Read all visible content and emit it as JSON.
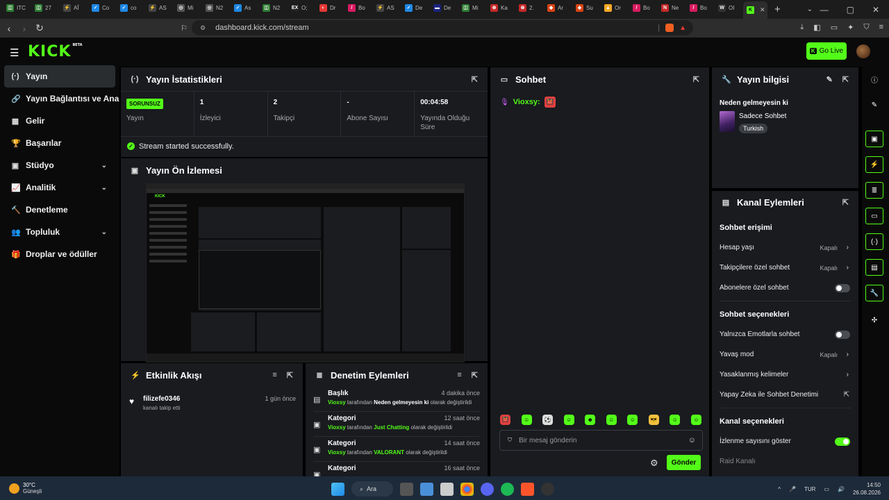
{
  "browser": {
    "tabs": [
      {
        "label": "ITC",
        "color": "#2e7d32",
        "glyph": "◫"
      },
      {
        "label": "27",
        "color": "#2e7d32",
        "glyph": "◫"
      },
      {
        "label": "AÎ",
        "color": "#444",
        "glyph": "⚡"
      },
      {
        "label": "Co",
        "color": "#1e88e5",
        "glyph": "✓"
      },
      {
        "label": "co",
        "color": "#1e88e5",
        "glyph": "✓"
      },
      {
        "label": "AS",
        "color": "#444",
        "glyph": "⚡"
      },
      {
        "label": "Mi",
        "color": "#555",
        "glyph": "◎"
      },
      {
        "label": "N2",
        "color": "#555",
        "glyph": "◎"
      },
      {
        "label": "As",
        "color": "#1e88e5",
        "glyph": "✓"
      },
      {
        "label": "N2",
        "color": "#2e7d32",
        "glyph": "◫"
      },
      {
        "label": "O;",
        "color": "#222",
        "glyph": "EX"
      },
      {
        "label": "Dr",
        "color": "#e53935",
        "glyph": "◐"
      },
      {
        "label": "Bo",
        "color": "#d81b60",
        "glyph": "/"
      },
      {
        "label": "AS",
        "color": "#444",
        "glyph": "⚡"
      },
      {
        "label": "De",
        "color": "#1e88e5",
        "glyph": "✓"
      },
      {
        "label": "De",
        "color": "#1a237e",
        "glyph": "▬"
      },
      {
        "label": "Mi",
        "color": "#2e7d32",
        "glyph": "◫"
      },
      {
        "label": "Ka",
        "color": "#c62828",
        "glyph": "⊗"
      },
      {
        "label": "2.",
        "color": "#c62828",
        "glyph": "⊗"
      },
      {
        "label": "Ar",
        "color": "#d84315",
        "glyph": "◆"
      },
      {
        "label": "Su",
        "color": "#d84315",
        "glyph": "◆"
      },
      {
        "label": "Or",
        "color": "#f9a825",
        "glyph": "▲"
      },
      {
        "label": "Bo",
        "color": "#d81b60",
        "glyph": "/"
      },
      {
        "label": "Ne",
        "color": "#c62828",
        "glyph": "N"
      },
      {
        "label": "Bo",
        "color": "#d81b60",
        "glyph": "/"
      },
      {
        "label": "OI",
        "color": "#333",
        "glyph": "W"
      },
      {
        "label": "",
        "color": "#53fc18",
        "glyph": "K",
        "active": true
      }
    ],
    "url": "dashboard.kick.com/stream"
  },
  "header": {
    "logo": "KICK",
    "logo_tag": "BETA",
    "go_live": "Go Live"
  },
  "sidebar": {
    "items": [
      {
        "label": "Yayın",
        "icon": "(·)",
        "active": true,
        "chevron": false
      },
      {
        "label": "Yayın Bağlantısı ve Anahtarı",
        "icon": "🔗",
        "chevron": false
      },
      {
        "label": "Gelir",
        "icon": "▦",
        "chevron": false
      },
      {
        "label": "Başarılar",
        "icon": "🏆",
        "chevron": false
      },
      {
        "label": "Stüdyo",
        "icon": "▣",
        "chevron": true
      },
      {
        "label": "Analitik",
        "icon": "📈",
        "chevron": true
      },
      {
        "label": "Denetleme",
        "icon": "🔨",
        "chevron": false
      },
      {
        "label": "Topluluk",
        "icon": "👥",
        "chevron": true
      },
      {
        "label": "Droplar ve ödüller",
        "icon": "🎁",
        "chevron": false
      }
    ]
  },
  "stats": {
    "title": "Yayın İstatistikleri",
    "status_badge": "SORUNSUZ",
    "status_label": "Yayın",
    "viewers_value": "1",
    "viewers_label": "İzleyici",
    "followers_value": "2",
    "followers_label": "Takipçi",
    "subs_value": "-",
    "subs_label": "Abone Sayısı",
    "uptime_value": "00:04:58",
    "uptime_label": "Yayında Olduğu Süre",
    "success_msg": "Stream started successfully."
  },
  "preview": {
    "title": "Yayın Ön İzlemesi"
  },
  "chat": {
    "title": "Sohbet",
    "messages": [
      {
        "user": "Vioxsy:",
        "emote": "👹"
      }
    ],
    "emotes": [
      "👹",
      "☺",
      "⚽",
      "☺",
      "☻",
      "☺",
      "☺",
      "😎",
      "☺",
      "☺"
    ],
    "input_placeholder": "Bir mesaj gönderin",
    "send_label": "Gönder"
  },
  "stream_info": {
    "title": "Yayın bilgisi",
    "stream_title": "Neden gelmeyesin ki",
    "category": "Sadece Sohbet",
    "tag": "Turkish"
  },
  "channel_actions": {
    "title": "Kanal Eylemleri",
    "chat_access_heading": "Sohbet erişimi",
    "account_age_label": "Hesap yaşı",
    "account_age_value": "Kapalı",
    "followers_only_label": "Takipçilere özel sohbet",
    "followers_only_value": "Kapalı",
    "subs_only_label": "Abonelere özel sohbet",
    "chat_options_heading": "Sohbet seçenekleri",
    "emotes_only_label": "Yalnızca Emotlarla sohbet",
    "slow_mode_label": "Yavaş mod",
    "slow_mode_value": "Kapalı",
    "banned_words_label": "Yasaklanmış kelimeler",
    "ai_mod_label": "Yapay Zeka ile Sohbet Denetimi",
    "channel_options_heading": "Kanal seçenekleri",
    "show_viewers_label": "İzlenme sayısını göster",
    "raid_label": "Raid Kanalı"
  },
  "activity": {
    "title": "Etkinlik Akışı",
    "items": [
      {
        "name": "filizefe0346",
        "time": "1 gün önce",
        "desc": "kanalı takip etti"
      }
    ]
  },
  "moderation": {
    "title": "Denetim Eylemleri",
    "items": [
      {
        "type": "Başlık",
        "time": "4 dakika önce",
        "user": "Vioxsy",
        "mid": " tarafından ",
        "value": "Neden gelmeyesin ki",
        "end": " olarak değiştirildi",
        "icon": "▤"
      },
      {
        "type": "Kategori",
        "time": "12 saat önce",
        "user": "Vioxsy",
        "mid": " tarafından ",
        "value": "Just Chatting",
        "end": " olarak değiştirildi",
        "icon": "▣"
      },
      {
        "type": "Kategori",
        "time": "14 saat önce",
        "user": "Vioxsy",
        "mid": " tarafından ",
        "value": "VALORANT",
        "end": " olarak değiştirildi",
        "icon": "▣"
      },
      {
        "type": "Kategori",
        "time": "16 saat önce",
        "user": "",
        "mid": "",
        "value": "",
        "end": "",
        "icon": "▣"
      }
    ]
  },
  "taskbar": {
    "temp": "30°C",
    "weather": "Güneşli",
    "search": "Ara",
    "lang": "TUR",
    "time": "14:50",
    "date": "26.08.2026"
  },
  "colors": {
    "accent": "#53fc18",
    "panel": "#191b1f",
    "bg": "#0a0a0a"
  }
}
